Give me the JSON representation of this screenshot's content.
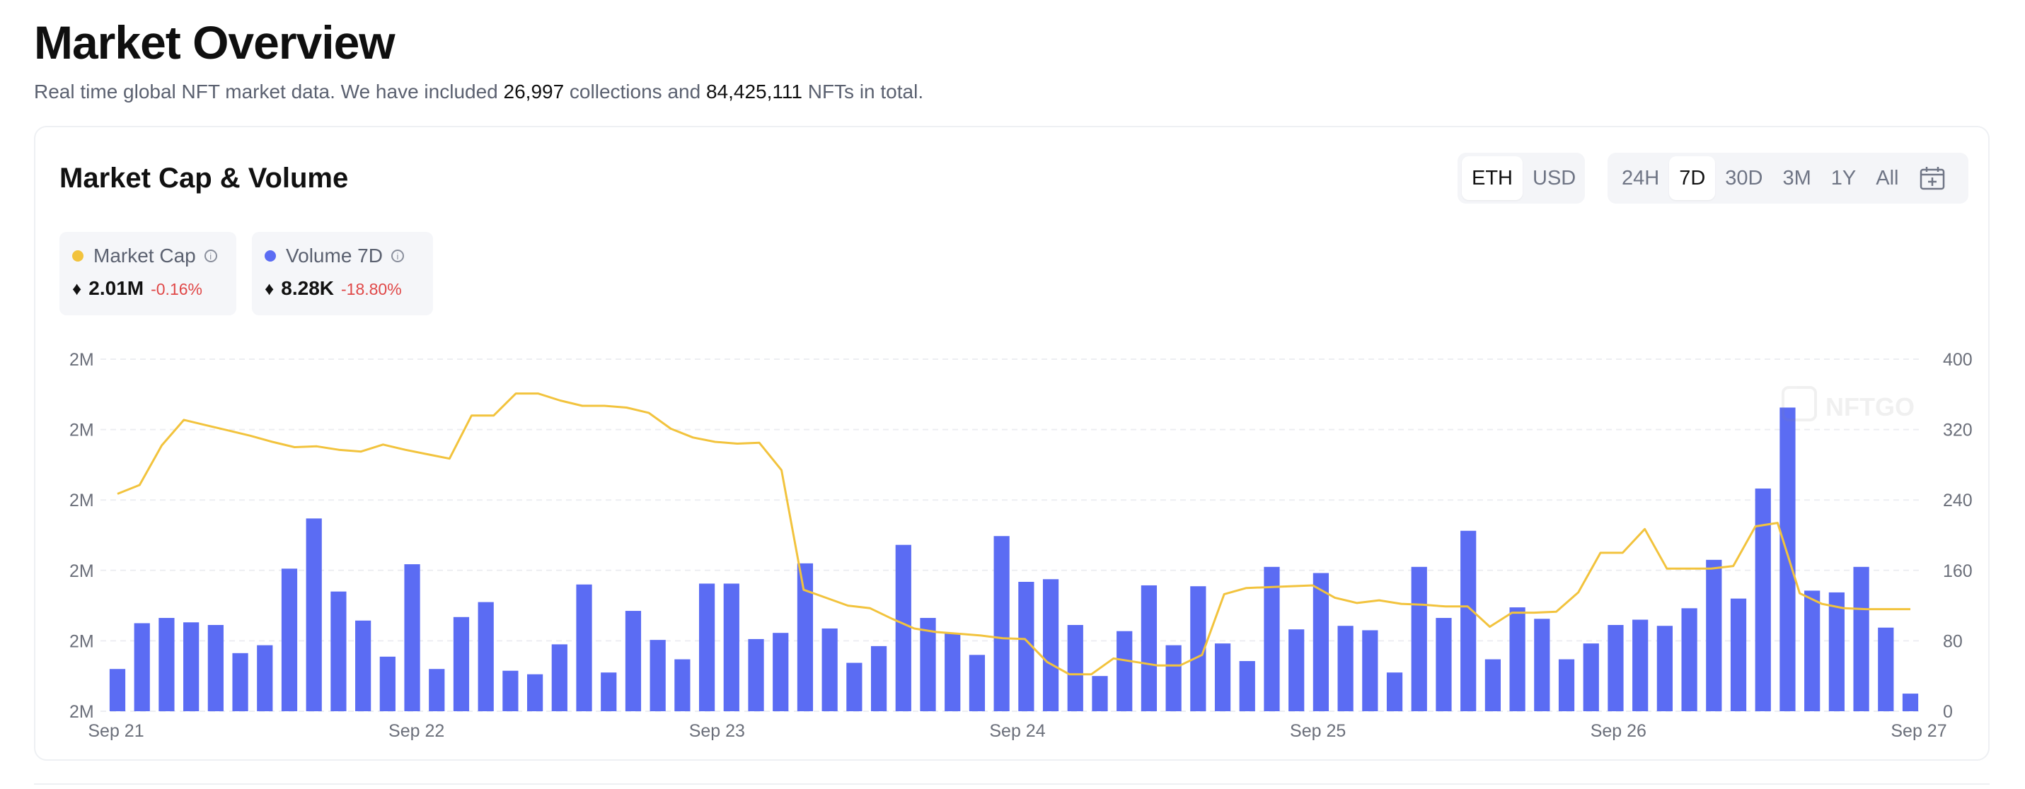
{
  "header": {
    "title": "Market Overview",
    "subtitle_pre": "Real time global NFT market data. We have included ",
    "collections_count": "26,997",
    "subtitle_mid": " collections and ",
    "nfts_count": "84,425,111",
    "subtitle_post": " NFTs in total."
  },
  "card": {
    "title": "Market Cap & Volume",
    "currency_options": [
      "ETH",
      "USD"
    ],
    "currency_selected": "ETH",
    "range_options": [
      "24H",
      "7D",
      "30D",
      "3M",
      "1Y",
      "All"
    ],
    "range_selected": "7D",
    "calendar_icon": "calendar-icon",
    "watermark": "NFTGO"
  },
  "legend": [
    {
      "name": "Market Cap",
      "value": "2.01M",
      "change": "-0.16%",
      "color": "#f2c33d",
      "eth_icon": "♦"
    },
    {
      "name": "Volume 7D",
      "value": "8.28K",
      "change": "-18.80%",
      "color": "#5b6cf3",
      "eth_icon": "♦"
    }
  ],
  "colors": {
    "bar": "#5b6cf3",
    "line": "#f2c33d",
    "negative": "#e04848"
  },
  "chart_data": {
    "type": "bar+line",
    "x_tick_labels": [
      "Sep 21",
      "Sep 22",
      "Sep 23",
      "Sep 24",
      "Sep 25",
      "Sep 26",
      "Sep 27"
    ],
    "y_left_tick_labels": [
      "2M",
      "2M",
      "2M",
      "2M",
      "2M",
      "2M"
    ],
    "y_right_ticks": [
      0,
      80,
      160,
      240,
      320,
      400
    ],
    "y_right_lim": [
      0,
      400
    ],
    "y_left_lim": [
      0,
      400
    ],
    "grid": true,
    "series": [
      {
        "name": "Volume 7D",
        "type": "bar",
        "axis": "right",
        "values": [
          48,
          100,
          106,
          101,
          98,
          66,
          75,
          162,
          219,
          136,
          103,
          62,
          167,
          48,
          107,
          124,
          46,
          42,
          76,
          144,
          44,
          114,
          81,
          59,
          145,
          145,
          82,
          89,
          168,
          94,
          55,
          74,
          189,
          106,
          89,
          64,
          199,
          147,
          150,
          98,
          40,
          91,
          143,
          75,
          142,
          77,
          57,
          164,
          93,
          157,
          97,
          92,
          44,
          164,
          106,
          205,
          59,
          118,
          105,
          59,
          77,
          98,
          104,
          97,
          117,
          172,
          128,
          253,
          345,
          137,
          135,
          164,
          95,
          20
        ],
        "values_approximate": true
      },
      {
        "name": "Market Cap",
        "type": "line",
        "axis": "left",
        "values": [
          247,
          257,
          302,
          331,
          325,
          319,
          313,
          306,
          300,
          301,
          297,
          295,
          303,
          297,
          292,
          287,
          336,
          336,
          361,
          361,
          353,
          347,
          347,
          345,
          339,
          321,
          311,
          306,
          304,
          305,
          274,
          138,
          129,
          120,
          117,
          105,
          94,
          90,
          88,
          86,
          83,
          82,
          56,
          42,
          42,
          60,
          56,
          52,
          52,
          64,
          133,
          140,
          141,
          142,
          143,
          129,
          123,
          126,
          122,
          121,
          119,
          119,
          96,
          112,
          112,
          113,
          135,
          180,
          180,
          207,
          162,
          162,
          162,
          165,
          210,
          214,
          134,
          122,
          117,
          116,
          116,
          116
        ],
        "values_approximate": true
      }
    ]
  }
}
